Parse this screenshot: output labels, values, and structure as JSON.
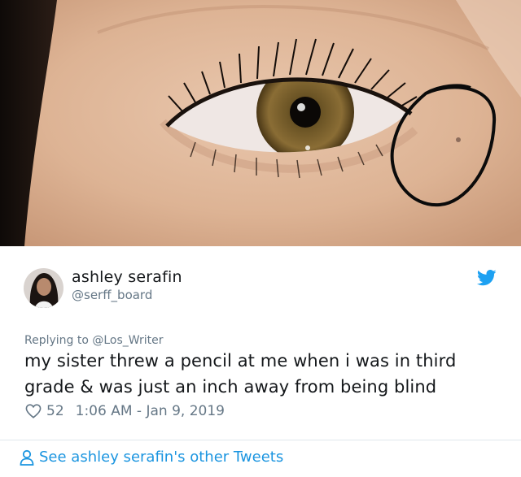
{
  "author": {
    "name": "ashley serafin",
    "handle": "@serff_board"
  },
  "reply": {
    "label": "Replying to @Los_Writer"
  },
  "tweet": {
    "text": "my sister threw a pencil at me when i was in third grade & was just an inch away from being blind",
    "likes": "52",
    "timestamp": "1:06 AM - Jan 9, 2019"
  },
  "footer": {
    "see_more": "See ashley serafin's other Tweets"
  },
  "icons": {
    "bird": "twitter-bird-icon",
    "heart": "heart-icon",
    "person": "person-icon"
  },
  "colors": {
    "brand_blue": "#1da1f2",
    "link_blue": "#1b95e0",
    "secondary_text": "#657786"
  }
}
